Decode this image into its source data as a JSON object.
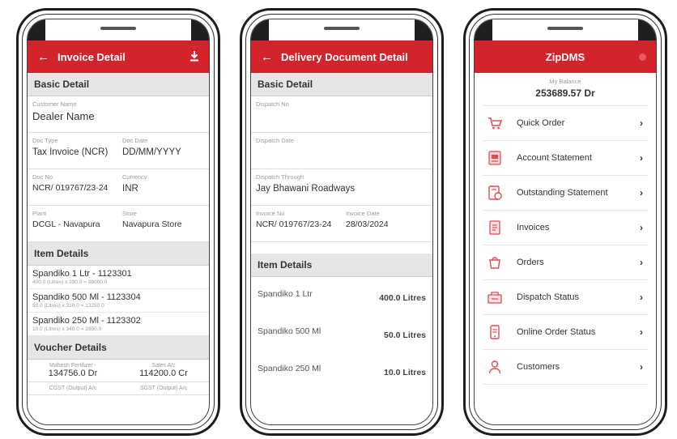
{
  "invoice_screen": {
    "title": "Invoice Detail",
    "basic_detail_header": "Basic Detail",
    "customer_name_label": "Customer Name",
    "customer_name_value": "Dealer Name",
    "doc_type_label": "Doc Type",
    "doc_type_value": "Tax Invoice (NCR)",
    "doc_date_label": "Doc Date",
    "doc_date_value": "DD/MM/YYYY",
    "doc_no_label": "Doc No",
    "doc_no_value": "NCR/ 019767/23-24",
    "currency_label": "Currency",
    "currency_value": "INR",
    "plant_label": "Plant",
    "plant_value": "DCGL - Navapura",
    "store_label": "Store",
    "store_value": "Navapura Store",
    "item_details_header": "Item Details",
    "items": [
      {
        "name": "Spandiko 1 Ltr - 1123301",
        "sub": "400.0 (Litres) x 290.0 = 98000.0"
      },
      {
        "name": "Spandiko 500 Ml - 1123304",
        "sub": "50.0 (Litres) x 310.0 = 13250.0"
      },
      {
        "name": "Spandiko 250 Ml - 1123302",
        "sub": "10.0 (Litres) x 340.0 = 2950.0"
      }
    ],
    "voucher_details_header": "Voucher Details",
    "vouchers": [
      {
        "label": "Mahesh Fertilizer -",
        "value": "134756.0 Dr"
      },
      {
        "label": "Sales A/c",
        "value": "114200.0 Cr"
      }
    ],
    "voucher_more": [
      "CGST (Output) A/c",
      "SGST (Output) A/c"
    ]
  },
  "delivery_screen": {
    "title": "Delivery Document Detail",
    "basic_detail_header": "Basic Detail",
    "dispatch_no_label": "Dispatch No",
    "dispatch_no_value": "",
    "dispatch_date_label": "Dispatch Date",
    "dispatch_date_value": "",
    "dispatch_through_label": "Dispatch Through",
    "dispatch_through_value": "Jay Bhawani Roadways",
    "invoice_no_label": "Invoice No",
    "invoice_no_value": "NCR/ 019767/23-24",
    "invoice_date_label": "Invoice Date",
    "invoice_date_value": "28/03/2024",
    "item_details_header": "Item Details",
    "items": [
      {
        "name": "Spandiko 1 Ltr",
        "qty": "400.0 Litres"
      },
      {
        "name": "Spandiko 500 Ml",
        "qty": "50.0 Litres"
      },
      {
        "name": "Spandiko 250 Ml",
        "qty": "10.0 Litres"
      }
    ]
  },
  "home_screen": {
    "title": "ZipDMS",
    "balance_label": "My Balance",
    "balance_value": "253689.57 Dr",
    "menu": [
      {
        "label": "Quick Order",
        "icon": "cart-icon"
      },
      {
        "label": "Account Statement",
        "icon": "statement-icon"
      },
      {
        "label": "Outstanding Statement",
        "icon": "outstanding-icon"
      },
      {
        "label": "Invoices",
        "icon": "invoice-icon"
      },
      {
        "label": "Orders",
        "icon": "orders-icon"
      },
      {
        "label": "Dispatch Status",
        "icon": "dispatch-icon"
      },
      {
        "label": "Online Order Status",
        "icon": "online-order-icon"
      },
      {
        "label": "Customers",
        "icon": "customer-icon"
      }
    ]
  },
  "colors": {
    "brand_red": "#d3242b",
    "section_gray": "#e6e6e6",
    "icon_red": "#e04a50"
  }
}
